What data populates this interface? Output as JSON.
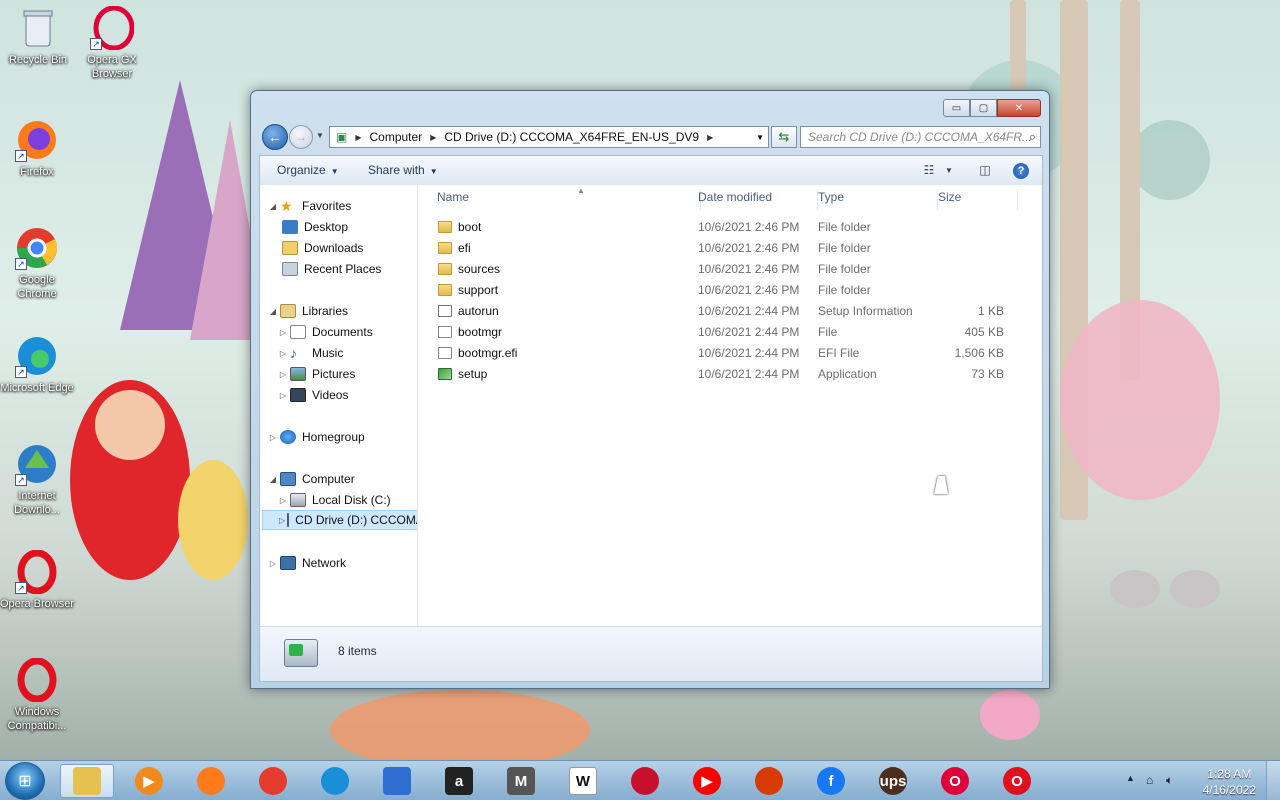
{
  "desktop": {
    "icons": [
      {
        "label": "Recycle Bin",
        "icon": "recycle-bin-icon"
      },
      {
        "label": "Opera GX Browser",
        "icon": "opera-gx-icon"
      },
      {
        "label": "Firefox",
        "icon": "firefox-icon"
      },
      {
        "label": "Google Chrome",
        "icon": "chrome-icon"
      },
      {
        "label": "Microsoft Edge",
        "icon": "edge-icon"
      },
      {
        "label": "Internet Downlo...",
        "icon": "idm-icon"
      },
      {
        "label": "Opera Browser",
        "icon": "opera-icon"
      },
      {
        "label": "Windows Compatibi...",
        "icon": "opera-icon"
      }
    ]
  },
  "window": {
    "controls": {
      "minimize": "▭",
      "maximize": "▢",
      "close": "✕"
    },
    "address": {
      "crumbs": [
        "Computer",
        "CD Drive (D:) CCCOMA_X64FRE_EN-US_DV9"
      ]
    },
    "search": {
      "placeholder": "Search CD Drive (D:) CCCOMA_X64FR..."
    },
    "toolbar": {
      "organize": "Organize",
      "share_with": "Share with"
    },
    "nav": {
      "favorites": "Favorites",
      "desktop": "Desktop",
      "downloads": "Downloads",
      "recent_places": "Recent Places",
      "libraries": "Libraries",
      "documents": "Documents",
      "music": "Music",
      "pictures": "Pictures",
      "videos": "Videos",
      "homegroup": "Homegroup",
      "computer": "Computer",
      "local_disk": "Local Disk (C:)",
      "cd_drive": "CD Drive (D:) CCCOMA_X64FRE_EN-US_DV9",
      "network": "Network"
    },
    "columns": {
      "name": "Name",
      "date": "Date modified",
      "type": "Type",
      "size": "Size"
    },
    "files": [
      {
        "name": "boot",
        "date": "10/6/2021 2:46 PM",
        "type": "File folder",
        "size": "",
        "kind": "folder"
      },
      {
        "name": "efi",
        "date": "10/6/2021 2:46 PM",
        "type": "File folder",
        "size": "",
        "kind": "folder"
      },
      {
        "name": "sources",
        "date": "10/6/2021 2:46 PM",
        "type": "File folder",
        "size": "",
        "kind": "folder"
      },
      {
        "name": "support",
        "date": "10/6/2021 2:46 PM",
        "type": "File folder",
        "size": "",
        "kind": "folder"
      },
      {
        "name": "autorun",
        "date": "10/6/2021 2:44 PM",
        "type": "Setup Information",
        "size": "1 KB",
        "kind": "setupinf"
      },
      {
        "name": "bootmgr",
        "date": "10/6/2021 2:44 PM",
        "type": "File",
        "size": "405 KB",
        "kind": "file"
      },
      {
        "name": "bootmgr.efi",
        "date": "10/6/2021 2:44 PM",
        "type": "EFI File",
        "size": "1,506 KB",
        "kind": "file"
      },
      {
        "name": "setup",
        "date": "10/6/2021 2:44 PM",
        "type": "Application",
        "size": "73 KB",
        "kind": "app"
      }
    ],
    "status": {
      "count": "8 items"
    }
  },
  "taskbar": {
    "apps": [
      {
        "name": "file-explorer",
        "glyph": ""
      },
      {
        "name": "media-player",
        "glyph": "▶"
      },
      {
        "name": "firefox",
        "glyph": ""
      },
      {
        "name": "chrome",
        "glyph": ""
      },
      {
        "name": "edge",
        "glyph": ""
      },
      {
        "name": "store",
        "glyph": ""
      },
      {
        "name": "amazon",
        "glyph": "a"
      },
      {
        "name": "m-app",
        "glyph": "M"
      },
      {
        "name": "wikipedia",
        "glyph": "W"
      },
      {
        "name": "bank",
        "glyph": ""
      },
      {
        "name": "youtube",
        "glyph": "▶"
      },
      {
        "name": "office",
        "glyph": ""
      },
      {
        "name": "facebook",
        "glyph": "f"
      },
      {
        "name": "ups",
        "glyph": "ups"
      },
      {
        "name": "opera-gx",
        "glyph": "O"
      },
      {
        "name": "opera",
        "glyph": "O"
      }
    ],
    "clock": {
      "time": "1:28 AM",
      "date": "4/16/2022"
    }
  }
}
